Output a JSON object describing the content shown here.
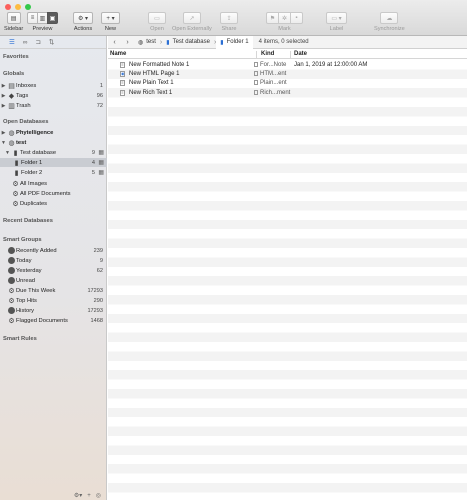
{
  "toolbar": {
    "sidebar_label": "Sidebar",
    "preview_label": "Preview",
    "actions_label": "Actions",
    "new_label": "New",
    "open_label": "Open",
    "open_externally_label": "Open Externally",
    "share_label": "Share",
    "mark_label": "Mark",
    "label_label": "Label",
    "synchronize_label": "Synchronize"
  },
  "sidebar": {
    "favorites": "Favorites",
    "globals": "Globals",
    "globals_items": [
      {
        "label": "Inboxes",
        "count": "1"
      },
      {
        "label": "Tags",
        "count": "96"
      },
      {
        "label": "Trash",
        "count": "72"
      }
    ],
    "open_databases": "Open Databases",
    "databases": [
      {
        "label": "Phytelligence"
      },
      {
        "label": "test"
      }
    ],
    "test_children": {
      "test_database": {
        "label": "Test database",
        "count": "9"
      },
      "folder1": {
        "label": "Folder 1",
        "count": "4"
      },
      "folder2": {
        "label": "Folder 2",
        "count": "5"
      },
      "all_images": "All Images",
      "all_pdf": "All PDF Documents",
      "duplicates": "Duplicates"
    },
    "recent_databases": "Recent Databases",
    "smart_groups": "Smart Groups",
    "smart_items": [
      {
        "label": "Recently Added",
        "count": "239"
      },
      {
        "label": "Today",
        "count": "9"
      },
      {
        "label": "Yesterday",
        "count": "62"
      },
      {
        "label": "Unread",
        "count": ""
      },
      {
        "label": "Due This Week",
        "count": "17293"
      },
      {
        "label": "Top Hits",
        "count": "290"
      },
      {
        "label": "History",
        "count": "17293"
      },
      {
        "label": "Flagged Documents",
        "count": "1468"
      }
    ],
    "smart_rules": "Smart Rules"
  },
  "pathbar": {
    "crumbs": [
      "test",
      "Test database",
      "Folder 1"
    ],
    "status": "4 items, 0 selected"
  },
  "table": {
    "columns": [
      "Name",
      "Kind",
      "Date"
    ],
    "rows": [
      {
        "name": "New Formatted Note 1",
        "kind": "For...Note",
        "date": "Jan 1, 2019 at 12:00:00 AM"
      },
      {
        "name": "New HTML Page 1",
        "kind": "HTM...ent",
        "date": ""
      },
      {
        "name": "New Plain Text 1",
        "kind": "Plain...ent",
        "date": ""
      },
      {
        "name": "New Rich Text 1",
        "kind": "Rich...ment",
        "date": ""
      }
    ]
  }
}
